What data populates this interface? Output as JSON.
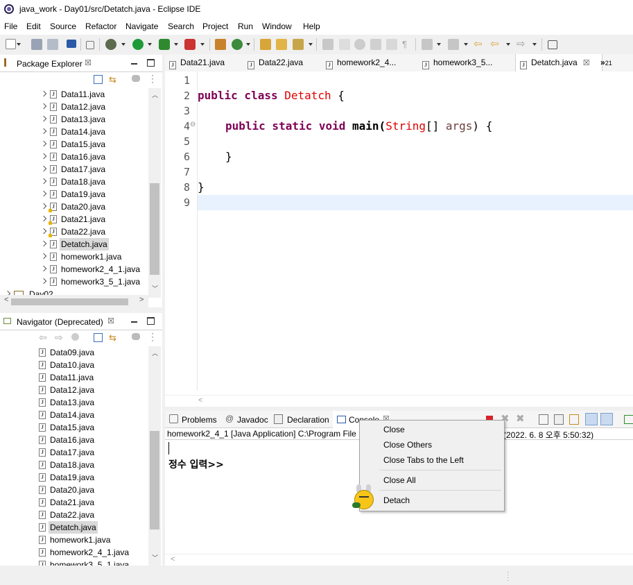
{
  "window": {
    "title": "java_work - Day01/src/Detatch.java - Eclipse IDE"
  },
  "menu": [
    "File",
    "Edit",
    "Source",
    "Refactor",
    "Navigate",
    "Search",
    "Project",
    "Run",
    "Window",
    "Help"
  ],
  "package_explorer": {
    "title": "Package Explorer",
    "items": [
      {
        "label": "Data11.java",
        "warn": false
      },
      {
        "label": "Data12.java",
        "warn": false
      },
      {
        "label": "Data13.java",
        "warn": false
      },
      {
        "label": "Data14.java",
        "warn": false
      },
      {
        "label": "Data15.java",
        "warn": false
      },
      {
        "label": "Data16.java",
        "warn": false
      },
      {
        "label": "Data17.java",
        "warn": false
      },
      {
        "label": "Data18.java",
        "warn": false
      },
      {
        "label": "Data19.java",
        "warn": false
      },
      {
        "label": "Data20.java",
        "warn": true
      },
      {
        "label": "Data21.java",
        "warn": true
      },
      {
        "label": "Data22.java",
        "warn": true
      },
      {
        "label": "Detatch.java",
        "warn": false,
        "selected": true
      },
      {
        "label": "homework1.java",
        "warn": false
      },
      {
        "label": "homework2_4_1.java",
        "warn": false
      },
      {
        "label": "homework3_5_1.java",
        "warn": false
      }
    ],
    "project_item": "Day02"
  },
  "navigator": {
    "title": "Navigator (Deprecated)",
    "items": [
      "Data09.java",
      "Data10.java",
      "Data11.java",
      "Data12.java",
      "Data13.java",
      "Data14.java",
      "Data15.java",
      "Data16.java",
      "Data17.java",
      "Data18.java",
      "Data19.java",
      "Data20.java",
      "Data21.java",
      "Data22.java",
      "Detatch.java",
      "homework1.java",
      "homework2_4_1.java",
      "homework3_5_1.java"
    ],
    "selected_index": 14
  },
  "editor": {
    "tabs": [
      "Data21.java",
      "Data22.java",
      "homework2_4...",
      "homework3_5...",
      "Detatch.java"
    ],
    "active_tab": "Detatch.java",
    "overflow": "21",
    "line_numbers": [
      "1",
      "2",
      "3",
      "4",
      "5",
      "6",
      "7",
      "8",
      "9"
    ],
    "code": {
      "l2_kw": "public class",
      "l2_cls": "Detatch",
      "l2_rest": " {",
      "l4_kw": "public static void",
      "l4_main": " main(",
      "l4_type": "String",
      "l4_mid": "[] ",
      "l4_arg": "args",
      "l4_rest": ") {",
      "l6": "}",
      "l8": "}"
    }
  },
  "console": {
    "tabs": [
      "Problems",
      "Javadoc",
      "Declaration",
      "Console"
    ],
    "header_left": "homework2_4_1 [Java Application] C:\\Program File",
    "header_right": "(2022. 6. 8 오후 5:50:32)",
    "output": "정수 입력>>"
  },
  "context_menu": {
    "items": [
      "Close",
      "Close Others",
      "Close Tabs to the Left",
      "Close All",
      "Detach"
    ]
  },
  "colors": {
    "keyword": "#7f0055",
    "class_name": "#e00000",
    "current_line": "#e8f2fe"
  }
}
